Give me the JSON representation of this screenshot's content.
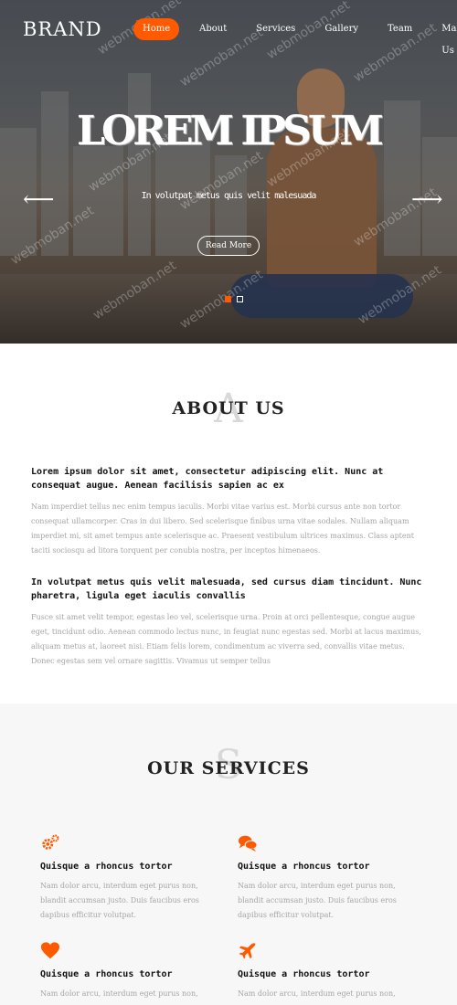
{
  "nav": {
    "brand": "BRAND",
    "items": [
      {
        "label": "Home",
        "active": true
      },
      {
        "label": "About"
      },
      {
        "label": "Services"
      },
      {
        "label": "Gallery"
      },
      {
        "label": "Team"
      },
      {
        "label": "Mail Us"
      }
    ]
  },
  "hero": {
    "title": "LOREM IPSUM",
    "subtitle": "In volutpat metus quis velit malesuada",
    "read_more": "Read More",
    "watermark": "webmoban.net",
    "slides": 2,
    "active_slide": 1
  },
  "about": {
    "letter": "A",
    "title": "ABOUT US",
    "heading1": "Lorem ipsum dolor sit amet, consectetur adipiscing elit. Nunc at consequat augue. Aenean facilisis sapien ac ex",
    "para1": "Nam imperdiet tellus nec enim tempus iaculis. Morbi vitae varius est. Morbi cursus ante non tortor consequat ullamcorper. Cras in dui libero. Sed scelerisque finibus urna vitae sodales. Nullam aliquam imperdiet mi, sit amet tempus ante scelerisque ac. Praesent vestibulum ultrices maximus. Class aptent taciti sociosqu ad litora torquent per conubia nostra, per inceptos himenaeos.",
    "heading2": "In volutpat metus quis velit malesuada, sed cursus diam tincidunt. Nunc pharetra, ligula eget iaculis convallis",
    "para2": "Fusce sit amet velit tempor, egestas leo vel, scelerisque urna. Proin at orci pellentesque, congue augue eget, tincidunt odio. Aenean commodo lectus nunc, in feugiat nunc egestas sed. Morbi at lacus maximus, aliquam metus at, laoreet nisi. Etiam felis lorem, condimentum ac viverra sed, convallis vitae metus. Donec egestas sem vel ornare sagittis. Vivamus ut semper tellus"
  },
  "services": {
    "letter": "S",
    "title": "OUR SERVICES",
    "items": [
      {
        "icon": "gears-icon",
        "title": "Quisque a rhoncus tortor",
        "text": "Nam dolor arcu, interdum eget purus non, blandit accumsan justo. Duis faucibus eros dapibus efficitur volutpat."
      },
      {
        "icon": "comments-icon",
        "title": "Quisque a rhoncus tortor",
        "text": "Nam dolor arcu, interdum eget purus non, blandit accumsan justo. Duis faucibus eros dapibus efficitur volutpat."
      },
      {
        "icon": "heart-icon",
        "title": "Quisque a rhoncus tortor",
        "text": "Nam dolor arcu, interdum eget purus non,"
      },
      {
        "icon": "plane-icon",
        "title": "Quisque a rhoncus tortor",
        "text": "Nam dolor arcu, interdum eget purus non,"
      }
    ]
  },
  "colors": {
    "accent": "#ff5a00"
  }
}
